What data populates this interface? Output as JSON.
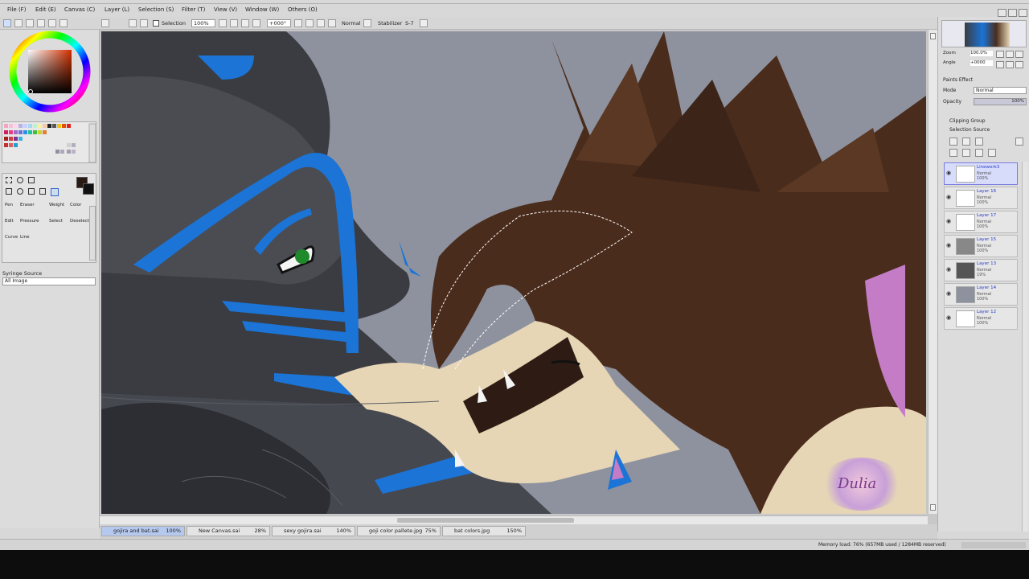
{
  "menu": {
    "items": [
      "File (F)",
      "Edit (E)",
      "Canvas (C)",
      "Layer (L)",
      "Selection (S)",
      "Filter (T)",
      "View (V)",
      "Window (W)",
      "Others (O)"
    ]
  },
  "toolbar": {
    "selection_label": "Selection",
    "zoom": "100%",
    "rotation": "+000°",
    "mode": "Normal",
    "stabilizer_label": "Stabilizer",
    "stabilizer_value": "S-7"
  },
  "left_panel": {
    "tools": [
      "Pen",
      "Eraser",
      "Weight",
      "Color",
      "Edit",
      "Pressure",
      "Select",
      "Deselect",
      "Curve",
      "Line"
    ],
    "syringe_label": "Syringe Source",
    "syringe_value": "All Image"
  },
  "right_panel": {
    "zoom_label": "Zoom",
    "zoom_value": "100.0%",
    "angle_label": "Angle",
    "angle_value": "+0000",
    "paint_effect_label": "Paints Effect",
    "mode_label": "Mode",
    "mode_value": "Normal",
    "opacity_label": "Opacity",
    "opacity_value": "100%",
    "clipping_label": "Clipping Group",
    "selection_source_label": "Selection Source",
    "layers": [
      {
        "name": "Linework3",
        "mode": "Normal",
        "opacity": "100%",
        "selected": true
      },
      {
        "name": "Layer 16",
        "mode": "Normal",
        "opacity": "100%",
        "selected": false
      },
      {
        "name": "Layer 17",
        "mode": "Normal",
        "opacity": "100%",
        "selected": false
      },
      {
        "name": "Layer 15",
        "mode": "Normal",
        "opacity": "100%",
        "selected": false
      },
      {
        "name": "Layer 13",
        "mode": "Normal",
        "opacity": "19%",
        "selected": false
      },
      {
        "name": "Layer 14",
        "mode": "Normal",
        "opacity": "100%",
        "selected": false
      },
      {
        "name": "Layer 12",
        "mode": "Normal",
        "opacity": "100%",
        "selected": false
      }
    ]
  },
  "tabs": [
    {
      "name": "gojira and bat.sai",
      "zoom": "100%",
      "active": true
    },
    {
      "name": "New Canvas.sai",
      "zoom": "28%",
      "active": false
    },
    {
      "name": "sexy gojira.sai",
      "zoom": "140%",
      "active": false
    },
    {
      "name": "goji color pallete.jpg",
      "zoom": "75%",
      "active": false
    },
    {
      "name": "bat colors.jpg",
      "zoom": "150%",
      "active": false
    }
  ],
  "status": {
    "memory": "Memory load: 76% (657MB used / 1284MB reserved)"
  },
  "colors": {
    "background": "#8e929e",
    "dark_fur": "#3a3c42",
    "blue_stripe": "#1b74d6",
    "brown_hair": "#4a2c1c",
    "skin": "#e6d6b6",
    "pink": "#c47cc6",
    "green_eye": "#1f8a2a"
  },
  "watermark": "Dulia"
}
